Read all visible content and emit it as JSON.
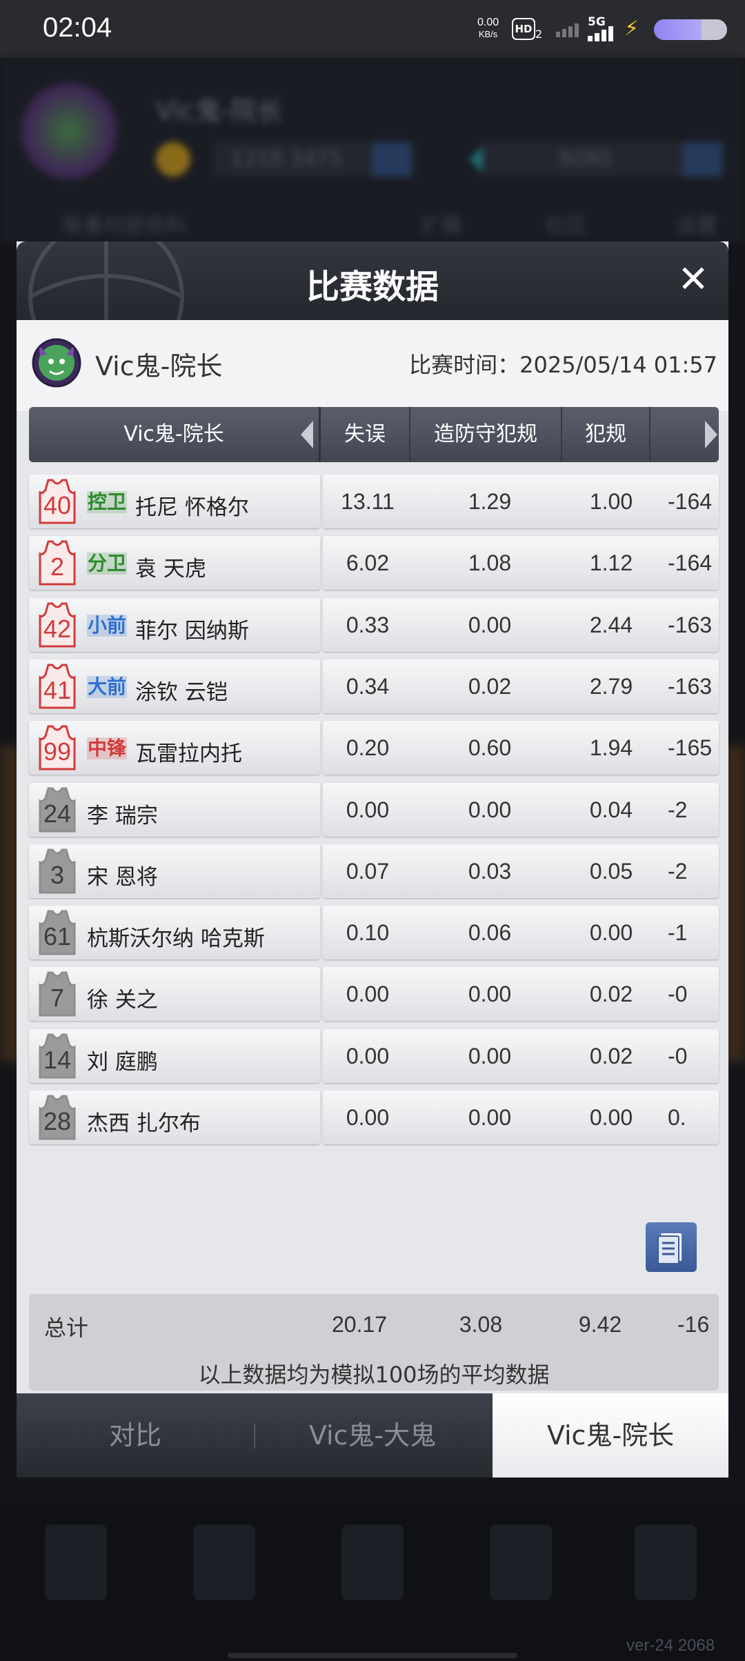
{
  "status_bar": {
    "time": "02:04",
    "net_speed": "0.00",
    "net_unit": "KB/s",
    "hd": "HD",
    "hd_sub": "2",
    "network": "5G",
    "battery_level": 0.65
  },
  "modal": {
    "title": "比赛数据",
    "close_glyph": "✕",
    "team_name": "Vic鬼-院长",
    "match_time": "比赛时间：2025/05/14 01:57",
    "header_team": "Vic鬼-院长",
    "columns": [
      "失误",
      "造防守犯规",
      "犯规"
    ],
    "players": [
      {
        "num": "40",
        "pos": "控卫",
        "pos_color": "#2f8a2f",
        "name": "托尼 怀格尔",
        "starter": true,
        "stats": [
          "13.11",
          "1.29",
          "1.00",
          "-164"
        ]
      },
      {
        "num": "2",
        "pos": "分卫",
        "pos_color": "#2f8a2f",
        "name": "袁 天虎",
        "starter": true,
        "stats": [
          "6.02",
          "1.08",
          "1.12",
          "-164"
        ]
      },
      {
        "num": "42",
        "pos": "小前",
        "pos_color": "#2f6fcf",
        "name": "菲尔 因纳斯",
        "starter": true,
        "stats": [
          "0.33",
          "0.00",
          "2.44",
          "-163"
        ]
      },
      {
        "num": "41",
        "pos": "大前",
        "pos_color": "#2f6fcf",
        "name": "涂钦 云铠",
        "starter": true,
        "stats": [
          "0.34",
          "0.02",
          "2.79",
          "-163"
        ]
      },
      {
        "num": "99",
        "pos": "中锋",
        "pos_color": "#d23a3a",
        "name": "瓦雷拉内托",
        "starter": true,
        "stats": [
          "0.20",
          "0.60",
          "1.94",
          "-165"
        ]
      },
      {
        "num": "24",
        "pos": "",
        "pos_color": "",
        "name": "李 瑞宗",
        "starter": false,
        "stats": [
          "0.00",
          "0.00",
          "0.04",
          "-2"
        ]
      },
      {
        "num": "3",
        "pos": "",
        "pos_color": "",
        "name": "宋 恩将",
        "starter": false,
        "stats": [
          "0.07",
          "0.03",
          "0.05",
          "-2"
        ]
      },
      {
        "num": "61",
        "pos": "",
        "pos_color": "",
        "name": "杭斯沃尔纳 哈克斯",
        "starter": false,
        "stats": [
          "0.10",
          "0.06",
          "0.00",
          "-1"
        ]
      },
      {
        "num": "7",
        "pos": "",
        "pos_color": "",
        "name": "徐 关之",
        "starter": false,
        "stats": [
          "0.00",
          "0.00",
          "0.02",
          "-0"
        ]
      },
      {
        "num": "14",
        "pos": "",
        "pos_color": "",
        "name": "刘 庭鹏",
        "starter": false,
        "stats": [
          "0.00",
          "0.00",
          "0.02",
          "-0"
        ]
      },
      {
        "num": "28",
        "pos": "",
        "pos_color": "",
        "name": "杰西 扎尔布",
        "starter": false,
        "stats": [
          "0.00",
          "0.00",
          "0.00",
          "0."
        ]
      }
    ],
    "totals": {
      "label": "总计",
      "values": [
        "20.17",
        "3.08",
        "9.42",
        "-16"
      ],
      "note": "以上数据均为模拟100场的平均数据"
    },
    "tabs": [
      {
        "label": "对比",
        "active": false
      },
      {
        "label": "Vic鬼-大鬼",
        "active": false
      },
      {
        "label": "Vic鬼-院长",
        "active": true
      }
    ]
  },
  "background": {
    "user_name": "Vic鬼-院长",
    "coins": "1218 3475",
    "gems": "8080",
    "row_left": "每番村部资料",
    "row_items": [
      "扩展",
      "社区",
      "设置"
    ],
    "version": "ver-24 2068"
  },
  "colors": {
    "starter_jersey": "#d23a3a",
    "bench_jersey": "#8d8d8d",
    "header_bar": "#4a4d59",
    "active_tab": "#ffffff"
  }
}
